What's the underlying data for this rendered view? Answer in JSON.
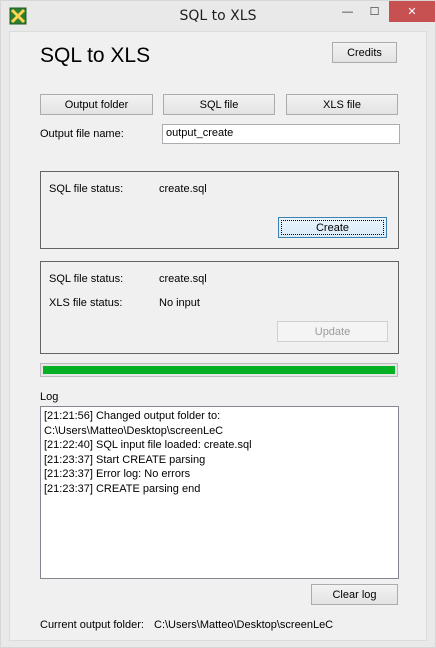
{
  "window": {
    "title": "SQL to XLS",
    "controls": {
      "minimize": "—",
      "maximize": "☐",
      "close": "✕"
    }
  },
  "header": {
    "title": "SQL to XLS",
    "credits_label": "Credits"
  },
  "toolbar": {
    "output_folder_label": "Output folder",
    "sql_file_label": "SQL file",
    "xls_file_label": "XLS file"
  },
  "output_file": {
    "label": "Output file name:",
    "value": "output_create"
  },
  "create_group": {
    "sql_status_label": "SQL file status:",
    "sql_status_value": "create.sql",
    "create_label": "Create"
  },
  "update_group": {
    "sql_status_label": "SQL file status:",
    "sql_status_value": "create.sql",
    "xls_status_label": "XLS file status:",
    "xls_status_value": "No input",
    "update_label": "Update"
  },
  "progress": {
    "fraction": 1.0,
    "color": "#06b025"
  },
  "log": {
    "label": "Log",
    "lines": [
      "[21:21:56] Changed output folder to:",
      "C:\\Users\\Matteo\\Desktop\\screenLeC",
      "[21:22:40] SQL input file loaded: create.sql",
      "[21:23:37] Start CREATE parsing",
      "[21:23:37] Error log: No errors",
      "[21:23:37] CREATE parsing end"
    ],
    "clear_label": "Clear log"
  },
  "footer": {
    "current_folder_label": "Current output folder:",
    "current_folder_value": "C:\\Users\\Matteo\\Desktop\\screenLeC"
  }
}
